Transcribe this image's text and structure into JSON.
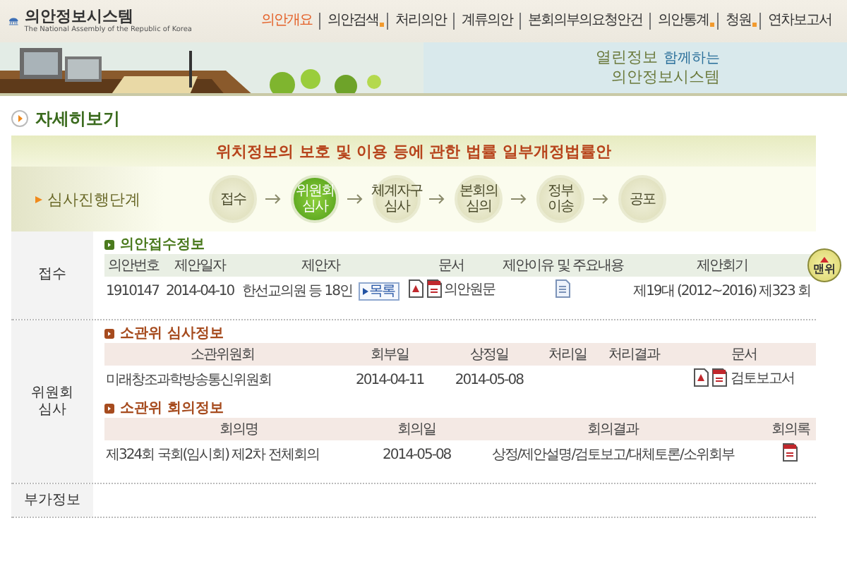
{
  "header": {
    "logo_title": "의안정보시스템",
    "logo_subtitle": "The National Assembly of the Republic of Korea",
    "nav": [
      {
        "label": "의안개요",
        "selected": true,
        "has_menu": false
      },
      {
        "label": "의안검색",
        "selected": false,
        "has_menu": true
      },
      {
        "label": "처리의안",
        "selected": false,
        "has_menu": false
      },
      {
        "label": "계류의안",
        "selected": false,
        "has_menu": false
      },
      {
        "label": "본회의부의요청안건",
        "selected": false,
        "has_menu": false
      },
      {
        "label": "의안통계",
        "selected": false,
        "has_menu": true
      },
      {
        "label": "청원",
        "selected": false,
        "has_menu": true
      },
      {
        "label": "연차보고서",
        "selected": false,
        "has_menu": false
      }
    ],
    "slogan": {
      "line1": "열린정보",
      "small": "함께하는",
      "line2": "의안정보시스템"
    }
  },
  "page_title": "자세히보기",
  "bill_title": "위치정보의 보호 및 이용 등에 관한 법률 일부개정법률안",
  "progress": {
    "label": "심사진행단계",
    "steps": [
      {
        "lines": [
          "접수"
        ],
        "selected": false
      },
      {
        "lines": [
          "위원회",
          "심사"
        ],
        "selected": true
      },
      {
        "lines": [
          "체계자구",
          "심사"
        ],
        "selected": false
      },
      {
        "lines": [
          "본회의",
          "심의"
        ],
        "selected": false
      },
      {
        "lines": [
          "정부",
          "이송"
        ],
        "selected": false
      },
      {
        "lines": [
          "공포"
        ],
        "selected": false
      }
    ]
  },
  "sections": [
    {
      "label": [
        "접수"
      ],
      "blocks": [
        {
          "heading": "의안접수정보",
          "color": "#4b7a1e",
          "columns": [
            "의안번호",
            "제안일자",
            "제안자",
            "문서",
            "제안이유 및 주요내용",
            "제안회기"
          ],
          "rows": [
            [
              {
                "kind": "text",
                "text": "1910147"
              },
              {
                "kind": "text",
                "text": "2014-04-10"
              },
              {
                "kind": "proposer",
                "text": "한선교의원 등 18인",
                "button": "목록"
              },
              {
                "kind": "files",
                "text": "의안원문"
              },
              {
                "kind": "doc"
              },
              {
                "kind": "text",
                "text": "제19대 (2012~2016) 제323 회"
              }
            ]
          ]
        }
      ]
    },
    {
      "label": [
        "위원회",
        "심사"
      ],
      "blocks": [
        {
          "heading": "소관위 심사정보",
          "color": "#a64b1e",
          "columns": [
            "소관위원회",
            "회부일",
            "상정일",
            "처리일",
            "처리결과",
            "문서"
          ],
          "rows": [
            [
              {
                "kind": "text",
                "text": "미래창조과학방송통신위원회"
              },
              {
                "kind": "text",
                "text": "2014-04-11"
              },
              {
                "kind": "text",
                "text": "2014-05-08"
              },
              {
                "kind": "blank"
              },
              {
                "kind": "blank"
              },
              {
                "kind": "files",
                "text": "검토보고서"
              }
            ]
          ]
        },
        {
          "heading": "소관위 회의정보",
          "color": "#a64b1e",
          "columns": [
            "회의명",
            "회의일",
            "회의결과",
            "회의록"
          ],
          "rows": [
            [
              {
                "kind": "text",
                "text": "제324회 국회(임시회) 제2차 전체회의"
              },
              {
                "kind": "text",
                "text": "2014-05-08"
              },
              {
                "kind": "text",
                "text": "상정/제안설명/검토보고/대체토론/소위회부"
              },
              {
                "kind": "pdf"
              }
            ]
          ]
        }
      ]
    },
    {
      "label": [
        "부가정보"
      ]
    }
  ],
  "top_button": "맨위"
}
